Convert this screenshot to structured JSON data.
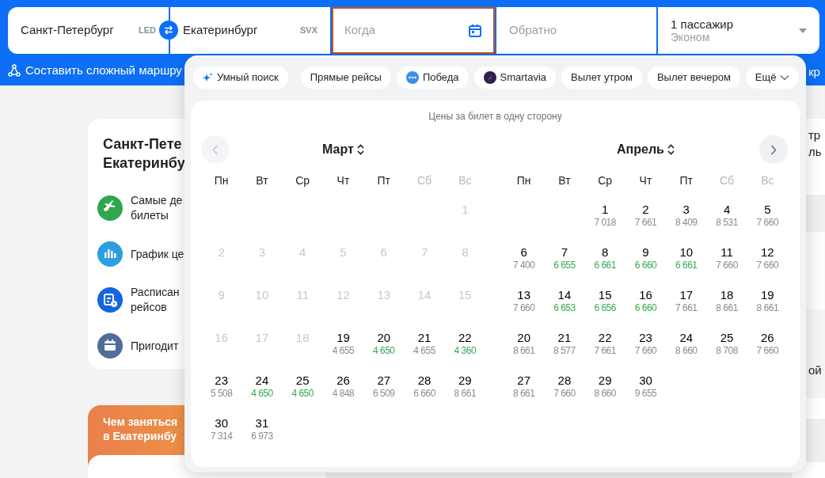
{
  "search_form": {
    "fields": [
      {
        "kind": "city",
        "value": "Санкт-Петербург",
        "code": "LED",
        "selected": false
      },
      {
        "kind": "city",
        "value": "Екатеринбург",
        "code": "SVX",
        "selected": false
      },
      {
        "kind": "date",
        "placeholder": "Когда",
        "selected": true
      },
      {
        "kind": "date",
        "placeholder": "Обратно",
        "selected": false
      },
      {
        "kind": "passengers",
        "value": "1 пассажир",
        "sub": "Эконом",
        "selected": false
      }
    ]
  },
  "route_link": "Составить сложный маршру",
  "right_link_fragment": "кр",
  "info_card": {
    "title_lines": [
      "Санкт-Пете",
      "Екатеринбу"
    ],
    "items": [
      {
        "kind": "plane",
        "color": "#2ea74d",
        "lines": [
          "Самые де",
          "билеты"
        ]
      },
      {
        "kind": "chart",
        "color": "#2b9fe0",
        "lines": [
          "График це"
        ]
      },
      {
        "kind": "schedule",
        "color": "#1565e0",
        "lines": [
          "Расписан",
          "рейсов"
        ]
      },
      {
        "kind": "bag",
        "color": "#4f6d96",
        "lines": [
          "Пригодит"
        ]
      }
    ]
  },
  "promo_card": {
    "title_lines": [
      "Чем заняться",
      "в Екатеринбу"
    ]
  },
  "side_fragments": [
    "тр",
    "ль",
    "ой"
  ],
  "date_popup": {
    "chips": [
      {
        "kind": "smart",
        "label": "Умный поиск"
      },
      {
        "kind": "plain",
        "label": "Прямые рейсы"
      },
      {
        "kind": "airline",
        "label": "Победа",
        "color": "#3b8ee8"
      },
      {
        "kind": "airline",
        "label": "Smartavia",
        "color": "#2a2350"
      },
      {
        "kind": "plain",
        "label": "Вылет утром"
      },
      {
        "kind": "plain",
        "label": "Вылет вечером"
      },
      {
        "kind": "more",
        "label": "Ещё"
      }
    ],
    "subtitle": "Цены за билет в одну сторону",
    "months": [
      {
        "title": "Март",
        "weekdays": [
          {
            "label": "Пн",
            "weekend": false
          },
          {
            "label": "Вт",
            "weekend": false
          },
          {
            "label": "Ср",
            "weekend": false
          },
          {
            "label": "Чт",
            "weekend": false
          },
          {
            "label": "Пт",
            "weekend": false
          },
          {
            "label": "Сб",
            "weekend": true
          },
          {
            "label": "Вс",
            "weekend": true
          }
        ],
        "days": [
          {
            "kind": "empty"
          },
          {
            "kind": "empty"
          },
          {
            "kind": "empty"
          },
          {
            "kind": "empty"
          },
          {
            "kind": "empty"
          },
          {
            "kind": "empty"
          },
          {
            "kind": "day",
            "day": "1",
            "disabled": true
          },
          {
            "kind": "day",
            "day": "2",
            "disabled": true
          },
          {
            "kind": "day",
            "day": "3",
            "disabled": true
          },
          {
            "kind": "day",
            "day": "4",
            "disabled": true
          },
          {
            "kind": "day",
            "day": "5",
            "disabled": true
          },
          {
            "kind": "day",
            "day": "6",
            "disabled": true
          },
          {
            "kind": "day",
            "day": "7",
            "disabled": true
          },
          {
            "kind": "day",
            "day": "8",
            "disabled": true
          },
          {
            "kind": "day",
            "day": "9",
            "disabled": true
          },
          {
            "kind": "day",
            "day": "10",
            "disabled": true
          },
          {
            "kind": "day",
            "day": "11",
            "disabled": true
          },
          {
            "kind": "day",
            "day": "12",
            "disabled": true
          },
          {
            "kind": "day",
            "day": "13",
            "disabled": true
          },
          {
            "kind": "day",
            "day": "14",
            "disabled": true
          },
          {
            "kind": "day",
            "day": "15",
            "disabled": true
          },
          {
            "kind": "day",
            "day": "16",
            "disabled": true
          },
          {
            "kind": "day",
            "day": "17",
            "disabled": true
          },
          {
            "kind": "day",
            "day": "18",
            "disabled": true
          },
          {
            "kind": "day",
            "day": "19",
            "price": "4 655",
            "disabled": false,
            "color": "#868c94"
          },
          {
            "kind": "day",
            "day": "20",
            "price": "4 650",
            "disabled": false,
            "color": "#34a853"
          },
          {
            "kind": "day",
            "day": "21",
            "price": "4 655",
            "disabled": false,
            "color": "#868c94"
          },
          {
            "kind": "day",
            "day": "22",
            "price": "4 360",
            "disabled": false,
            "color": "#34a853"
          },
          {
            "kind": "day",
            "day": "23",
            "price": "5 508",
            "disabled": false,
            "color": "#868c94"
          },
          {
            "kind": "day",
            "day": "24",
            "price": "4 650",
            "disabled": false,
            "color": "#34a853"
          },
          {
            "kind": "day",
            "day": "25",
            "price": "4 650",
            "disabled": false,
            "color": "#34a853"
          },
          {
            "kind": "day",
            "day": "26",
            "price": "4 848",
            "disabled": false,
            "color": "#868c94"
          },
          {
            "kind": "day",
            "day": "27",
            "price": "6 509",
            "disabled": false,
            "color": "#868c94"
          },
          {
            "kind": "day",
            "day": "28",
            "price": "6 660",
            "disabled": false,
            "color": "#868c94"
          },
          {
            "kind": "day",
            "day": "29",
            "price": "8 661",
            "disabled": false,
            "color": "#868c94"
          },
          {
            "kind": "day",
            "day": "30",
            "price": "7 314",
            "disabled": false,
            "color": "#868c94"
          },
          {
            "kind": "day",
            "day": "31",
            "price": "6 973",
            "disabled": false,
            "color": "#868c94"
          }
        ]
      },
      {
        "title": "Апрель",
        "weekdays": [
          {
            "label": "Пн",
            "weekend": false
          },
          {
            "label": "Вт",
            "weekend": false
          },
          {
            "label": "Ср",
            "weekend": false
          },
          {
            "label": "Чт",
            "weekend": false
          },
          {
            "label": "Пт",
            "weekend": false
          },
          {
            "label": "Сб",
            "weekend": true
          },
          {
            "label": "Вс",
            "weekend": true
          }
        ],
        "days": [
          {
            "kind": "empty"
          },
          {
            "kind": "empty"
          },
          {
            "kind": "day",
            "day": "1",
            "price": "7 018",
            "disabled": false,
            "color": "#868c94"
          },
          {
            "kind": "day",
            "day": "2",
            "price": "7 661",
            "disabled": false,
            "color": "#868c94"
          },
          {
            "kind": "day",
            "day": "3",
            "price": "8 409",
            "disabled": false,
            "color": "#868c94"
          },
          {
            "kind": "day",
            "day": "4",
            "price": "8 531",
            "disabled": false,
            "color": "#868c94"
          },
          {
            "kind": "day",
            "day": "5",
            "price": "7 660",
            "disabled": false,
            "color": "#868c94"
          },
          {
            "kind": "day",
            "day": "6",
            "price": "7 400",
            "disabled": false,
            "color": "#868c94"
          },
          {
            "kind": "day",
            "day": "7",
            "price": "6 655",
            "disabled": false,
            "color": "#34a853"
          },
          {
            "kind": "day",
            "day": "8",
            "price": "6 661",
            "disabled": false,
            "color": "#34a853"
          },
          {
            "kind": "day",
            "day": "9",
            "price": "6 660",
            "disabled": false,
            "color": "#34a853"
          },
          {
            "kind": "day",
            "day": "10",
            "price": "6 661",
            "disabled": false,
            "color": "#34a853"
          },
          {
            "kind": "day",
            "day": "11",
            "price": "7 660",
            "disabled": false,
            "color": "#868c94"
          },
          {
            "kind": "day",
            "day": "12",
            "price": "7 660",
            "disabled": false,
            "color": "#868c94"
          },
          {
            "kind": "day",
            "day": "13",
            "price": "7 660",
            "disabled": false,
            "color": "#868c94"
          },
          {
            "kind": "day",
            "day": "14",
            "price": "6 653",
            "disabled": false,
            "color": "#34a853"
          },
          {
            "kind": "day",
            "day": "15",
            "price": "6 656",
            "disabled": false,
            "color": "#34a853"
          },
          {
            "kind": "day",
            "day": "16",
            "price": "6 660",
            "disabled": false,
            "color": "#34a853"
          },
          {
            "kind": "day",
            "day": "17",
            "price": "7 661",
            "disabled": false,
            "color": "#868c94"
          },
          {
            "kind": "day",
            "day": "18",
            "price": "8 661",
            "disabled": false,
            "color": "#868c94"
          },
          {
            "kind": "day",
            "day": "19",
            "price": "8 661",
            "disabled": false,
            "color": "#868c94"
          },
          {
            "kind": "day",
            "day": "20",
            "price": "8 661",
            "disabled": false,
            "color": "#868c94"
          },
          {
            "kind": "day",
            "day": "21",
            "price": "8 577",
            "disabled": false,
            "color": "#868c94"
          },
          {
            "kind": "day",
            "day": "22",
            "price": "7 661",
            "disabled": false,
            "color": "#868c94"
          },
          {
            "kind": "day",
            "day": "23",
            "price": "7 660",
            "disabled": false,
            "color": "#868c94"
          },
          {
            "kind": "day",
            "day": "24",
            "price": "8 660",
            "disabled": false,
            "color": "#868c94"
          },
          {
            "kind": "day",
            "day": "25",
            "price": "8 708",
            "disabled": false,
            "color": "#868c94"
          },
          {
            "kind": "day",
            "day": "26",
            "price": "7 660",
            "disabled": false,
            "color": "#868c94"
          },
          {
            "kind": "day",
            "day": "27",
            "price": "8 661",
            "disabled": false,
            "color": "#868c94"
          },
          {
            "kind": "day",
            "day": "28",
            "price": "7 660",
            "disabled": false,
            "color": "#868c94"
          },
          {
            "kind": "day",
            "day": "29",
            "price": "8 660",
            "disabled": false,
            "color": "#868c94"
          },
          {
            "kind": "day",
            "day": "30",
            "price": "9 655",
            "disabled": false,
            "color": "#868c94"
          }
        ]
      }
    ]
  }
}
